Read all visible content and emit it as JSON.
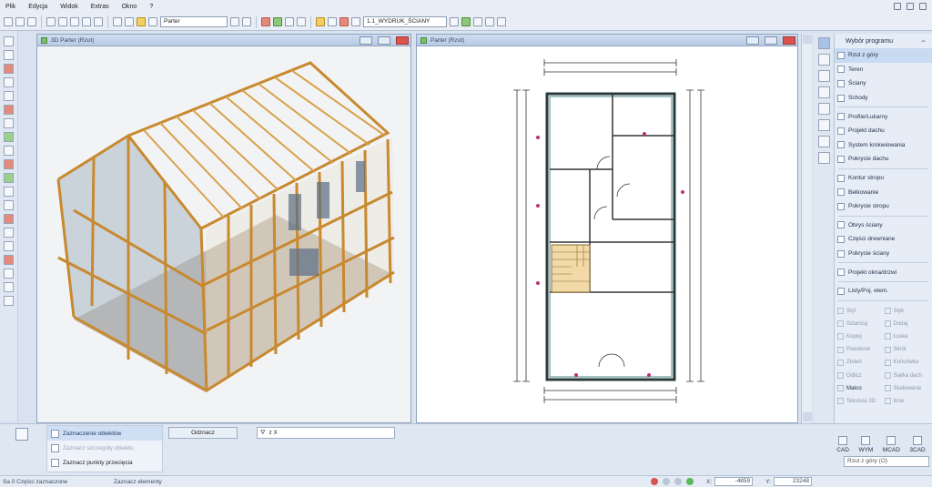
{
  "menu": {
    "items": [
      "Plik",
      "Edycja",
      "Widok",
      "Extras",
      "Okno",
      "?"
    ]
  },
  "toolbar": {
    "floor": "Parter",
    "plot": "1.1_WYDRUK_ŚCIANY"
  },
  "views": {
    "view3d": {
      "title": "3D Parter (Rzut)"
    },
    "plan": {
      "title": "Parter (Rzut)"
    }
  },
  "programs": {
    "header": "Wybór programu",
    "groups": [
      [
        "Rzut z góry",
        "Teren",
        "Ściany",
        "Schody"
      ],
      [
        "Profile/Lukarny",
        "Projekt dachu",
        "System krokwiowania",
        "Pokrycie dachu"
      ],
      [
        "Kontur stropu",
        "Belkowanie",
        "Pokrycie stropu"
      ],
      [
        "Obrys ściany",
        "Części drewniane",
        "Pokrycie ściany"
      ],
      [
        "Projekt okna/drzwi"
      ],
      [
        "Listy/Poj. elem."
      ]
    ],
    "tools": [
      [
        "Styl",
        "Styk"
      ],
      [
        "Sztancuj",
        "Dodaj"
      ],
      [
        "Kopiuj",
        "Łuska"
      ],
      [
        "Pokolenie",
        "Skrót"
      ],
      [
        "Zmień",
        "Końcówka"
      ],
      [
        "Odlicz",
        "Siatka dach"
      ],
      [
        "Makro",
        "Skalowanie"
      ],
      [
        "Tekstura 3D",
        "Inne"
      ]
    ],
    "enabled_tools": [
      "Makro"
    ]
  },
  "selection": {
    "rows": [
      "Zaznaczenie obiektów",
      "Zaznacz szczegóły obiektu",
      "Zaznacz punkty przecięcia"
    ],
    "deselect": "Odznacz",
    "filter": "z X"
  },
  "cad_switch": [
    "CAD",
    "WYM",
    "MCAD",
    "3CAD"
  ],
  "view_select": "Rzut z góry (O)",
  "status": {
    "left": "Sa 0 Części zaznaczone",
    "mid": "Zaznacz elementy",
    "x_label": "X:",
    "x_value": "-4859",
    "y_label": "Y:",
    "y_value": "23248"
  }
}
